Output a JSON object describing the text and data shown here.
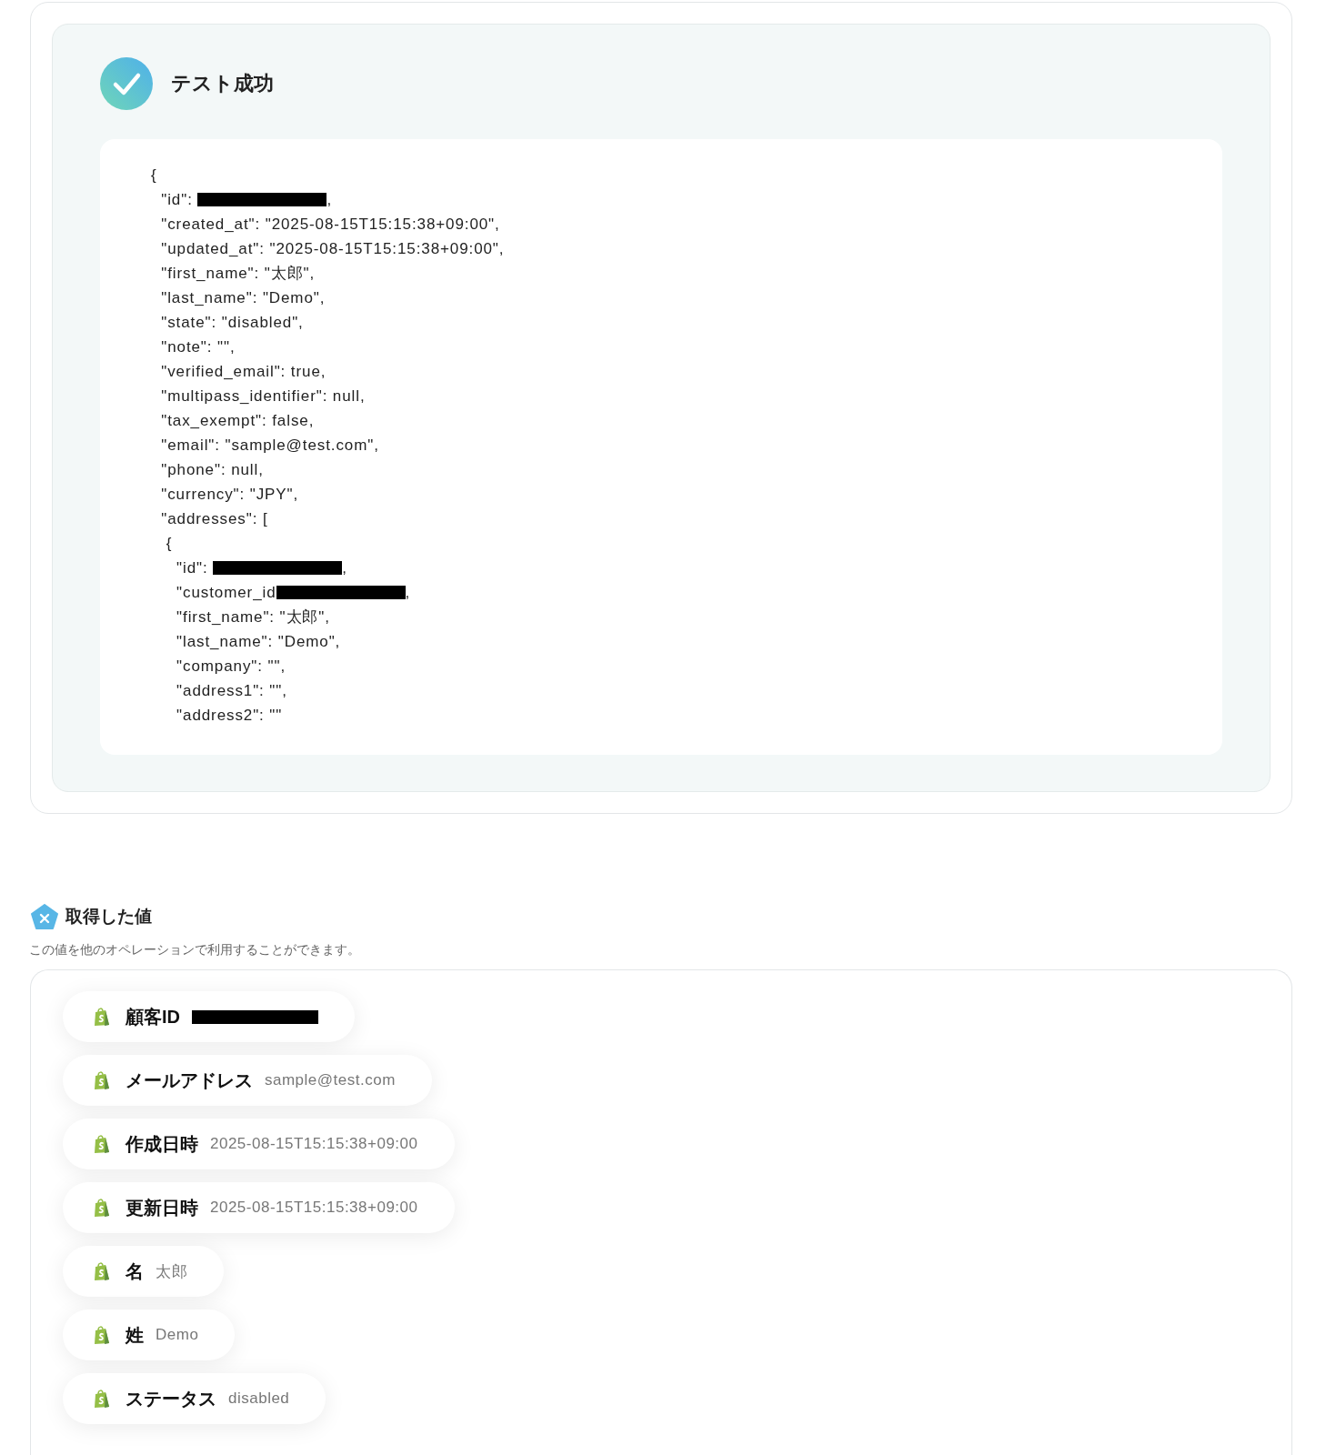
{
  "result": {
    "title": "テスト成功",
    "code_lines": [
      {
        "text": "{"
      },
      {
        "text": "  \"id\": ",
        "redacted": true,
        "after": ","
      },
      {
        "text": "  \"created_at\": \"2025-08-15T15:15:38+09:00\","
      },
      {
        "text": "  \"updated_at\": \"2025-08-15T15:15:38+09:00\","
      },
      {
        "text": "  \"first_name\": \"太郎\","
      },
      {
        "text": "  \"last_name\": \"Demo\","
      },
      {
        "text": "  \"state\": \"disabled\","
      },
      {
        "text": "  \"note\": \"\","
      },
      {
        "text": "  \"verified_email\": true,"
      },
      {
        "text": "  \"multipass_identifier\": null,"
      },
      {
        "text": "  \"tax_exempt\": false,"
      },
      {
        "text": "  \"email\": \"sample@test.com\","
      },
      {
        "text": "  \"phone\": null,"
      },
      {
        "text": "  \"currency\": \"JPY\","
      },
      {
        "text": "  \"addresses\": ["
      },
      {
        "text": "   {"
      },
      {
        "text": "     \"id\": ",
        "redacted": true,
        "after": ","
      },
      {
        "text": "     \"customer_id",
        "redacted": true,
        "after": ","
      },
      {
        "text": "     \"first_name\": \"太郎\","
      },
      {
        "text": "     \"last_name\": \"Demo\","
      },
      {
        "text": "     \"company\": \"\","
      },
      {
        "text": "     \"address1\": \"\","
      },
      {
        "text": "     \"address2\": \"\""
      }
    ]
  },
  "values": {
    "title": "取得した値",
    "description": "この値を他のオペレーションで利用することができます。",
    "items": [
      {
        "label": "顧客ID",
        "redacted": true
      },
      {
        "label": "メールアドレス",
        "value": "sample@test.com"
      },
      {
        "label": "作成日時",
        "value": "2025-08-15T15:15:38+09:00"
      },
      {
        "label": "更新日時",
        "value": "2025-08-15T15:15:38+09:00"
      },
      {
        "label": "名",
        "value": "太郎"
      },
      {
        "label": "姓",
        "value": "Demo"
      },
      {
        "label": "ステータス",
        "value": "disabled"
      }
    ]
  }
}
